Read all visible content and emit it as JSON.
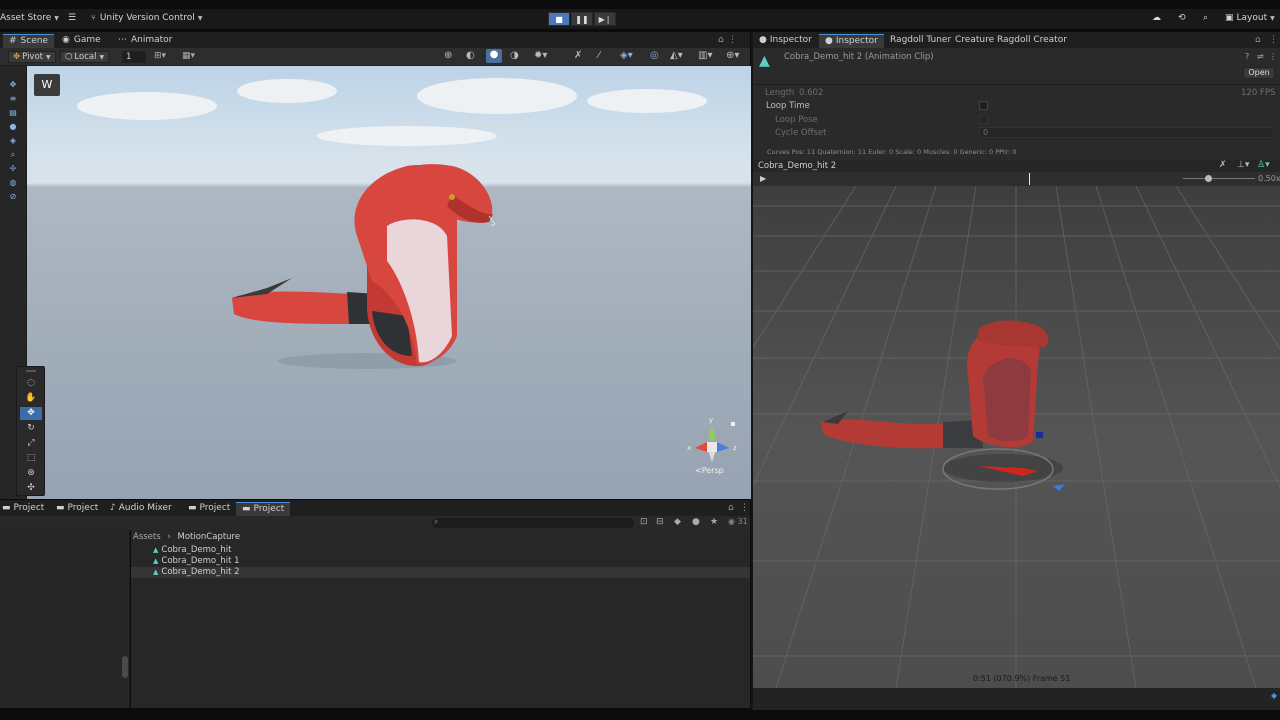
{
  "topbar": {
    "asset_store": "Asset Store",
    "version_control": "Unity Version Control",
    "layout": "Layout"
  },
  "scene_tabs": [
    {
      "label": "Scene",
      "selected": true
    },
    {
      "label": "Game",
      "selected": false
    },
    {
      "label": "Animator",
      "selected": false
    }
  ],
  "scene_toolbar": {
    "pivot": "Pivot",
    "local": "Local",
    "grid_snap_value": "1"
  },
  "scene_view": {
    "projection_label": "Persp",
    "gizmo_y": "y",
    "gizmo_x": "x",
    "gizmo_z": "z"
  },
  "project_tabs": [
    {
      "label": "Project",
      "selected": false
    },
    {
      "label": "Project",
      "selected": false
    },
    {
      "label": "Audio Mixer",
      "selected": false
    },
    {
      "label": "Project",
      "selected": false
    },
    {
      "label": "Project",
      "selected": true
    }
  ],
  "project": {
    "breadcrumb_root": "Assets",
    "breadcrumb_folder": "MotionCapture",
    "item_count": "31",
    "assets": [
      {
        "name": "Cobra_Demo_hit",
        "selected": false
      },
      {
        "name": "Cobra_Demo_hit 1",
        "selected": false
      },
      {
        "name": "Cobra_Demo_hit 2",
        "selected": true
      }
    ]
  },
  "inspector_tabs": [
    {
      "label": "Inspector",
      "selected": false
    },
    {
      "label": "Inspector",
      "selected": true
    },
    {
      "label": "Ragdoll Tuner",
      "selected": false
    },
    {
      "label": "Creature Ragdoll Creator",
      "selected": false
    }
  ],
  "inspector": {
    "asset_title": "Cobra_Demo_hit 2 (Animation Clip)",
    "open_button": "Open",
    "length_label": "Length",
    "length_value": "0.602",
    "fps": "120 FPS",
    "loop_time_label": "Loop Time",
    "loop_pose_label": "Loop Pose",
    "cycle_offset_label": "Cycle Offset",
    "cycle_offset_value": "0",
    "curves_info": "Curves Pos: 11 Quaternion: 11 Euler: 0 Scale: 0 Muscles: 0 Generic: 0 PPtr: 0"
  },
  "preview": {
    "clip_name": "Cobra_Demo_hit 2",
    "speed": "0.50x",
    "timeline_position": 0.61,
    "speed_slider_position": 0.35,
    "status": "0:51 (070.9%) Frame 51"
  },
  "colors": {
    "accent": "#4a90d9",
    "snake_red": "#d8473f",
    "snake_belly": "#e8d6da",
    "panel_bg": "#2a2a2a"
  }
}
